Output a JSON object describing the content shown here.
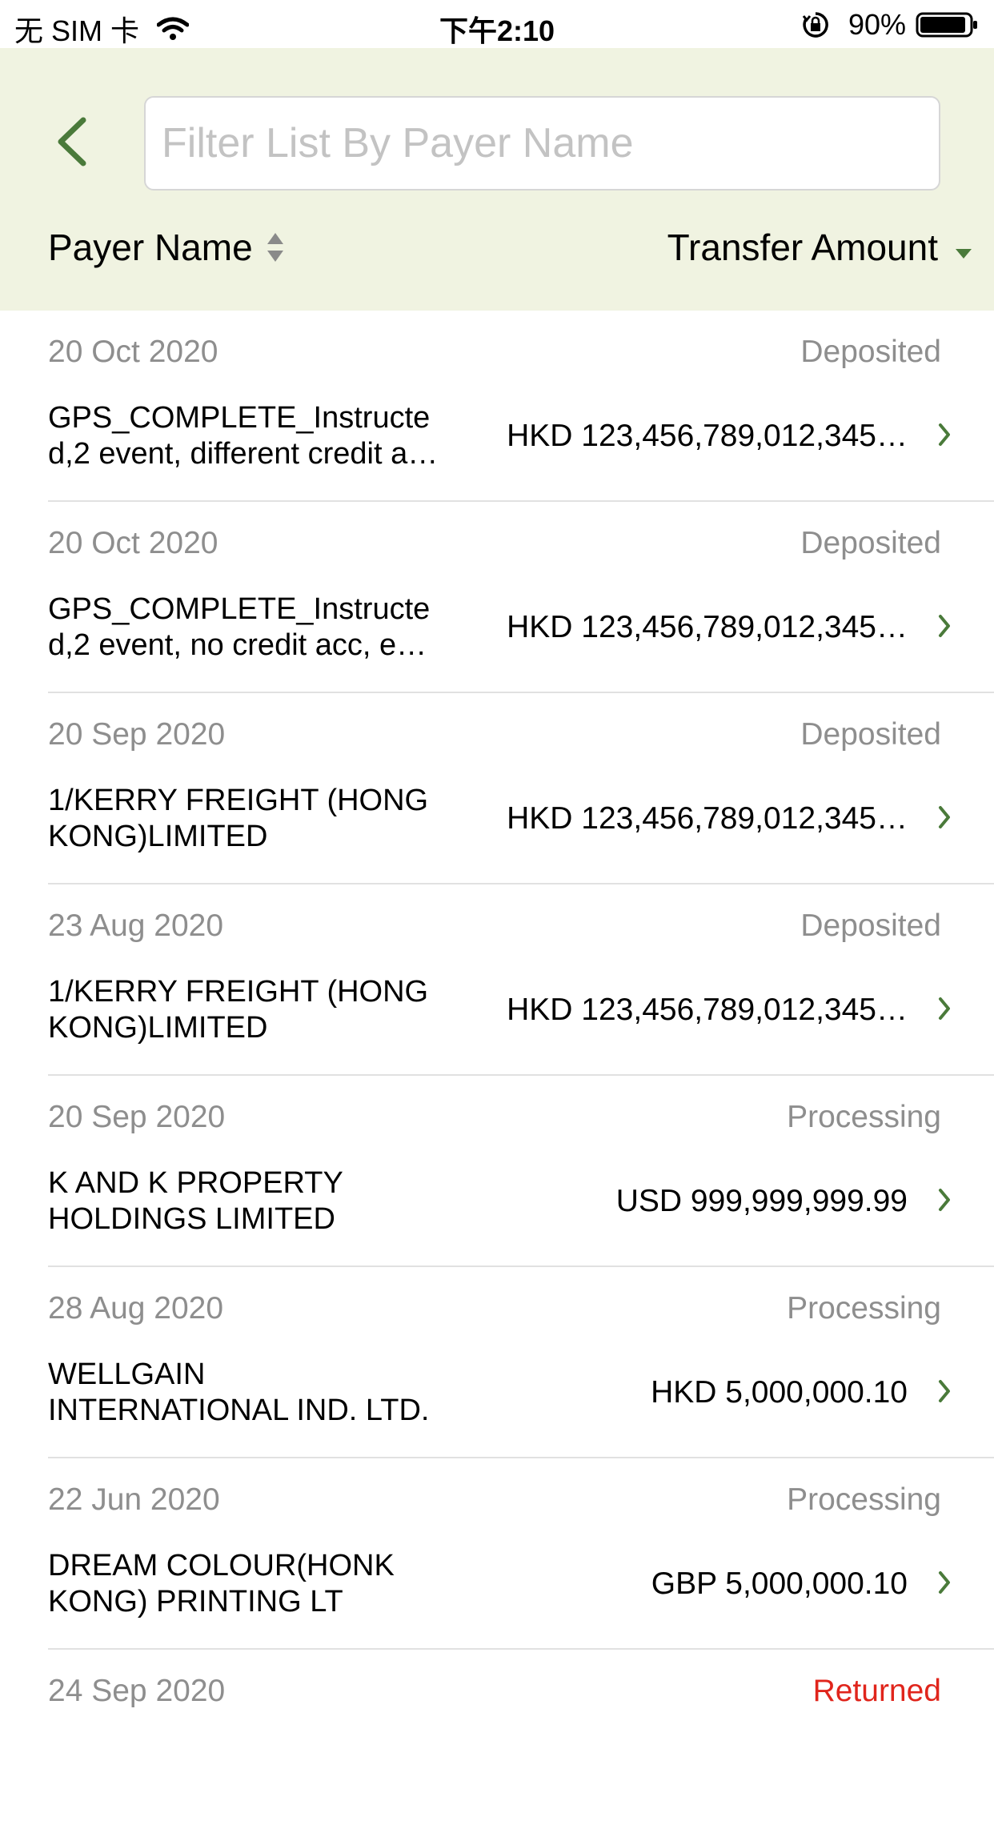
{
  "status_bar": {
    "carrier": "无 SIM 卡",
    "time": "下午2:10",
    "battery": "90%"
  },
  "header": {
    "search": {
      "placeholder": "Filter List By Payer Name",
      "value": ""
    },
    "sort_payer_label": "Payer Name",
    "sort_amount_label": "Transfer Amount",
    "accent_color": "#4a7a3a",
    "background_color": "#f0f3e1"
  },
  "transactions": [
    {
      "date": "20 Oct 2020",
      "status": "Deposited",
      "payer_line1": "GPS_COMPLETE_Instructe",
      "payer_line2": "d,2 event, different credit a…",
      "amount": "HKD 123,456,789,012,345…"
    },
    {
      "date": "20 Oct 2020",
      "status": "Deposited",
      "payer_line1": "GPS_COMPLETE_Instructe",
      "payer_line2": "d,2 event, no credit acc, e…",
      "amount": "HKD 123,456,789,012,345…"
    },
    {
      "date": "20 Sep 2020",
      "status": "Deposited",
      "payer_line1": "1/KERRY FREIGHT (HONG",
      "payer_line2": "KONG)LIMITED",
      "amount": "HKD 123,456,789,012,345…"
    },
    {
      "date": "23 Aug 2020",
      "status": "Deposited",
      "payer_line1": "1/KERRY FREIGHT (HONG",
      "payer_line2": "KONG)LIMITED",
      "amount": "HKD 123,456,789,012,345…"
    },
    {
      "date": "20 Sep 2020",
      "status": "Processing",
      "payer_line1": "K AND K PROPERTY",
      "payer_line2": "HOLDINGS LIMITED",
      "amount": "USD 999,999,999.99"
    },
    {
      "date": "28 Aug 2020",
      "status": "Processing",
      "payer_line1": "WELLGAIN",
      "payer_line2": "INTERNATIONAL IND. LTD.",
      "amount": "HKD 5,000,000.10"
    },
    {
      "date": "22 Jun 2020",
      "status": "Processing",
      "payer_line1": "DREAM COLOUR(HONK",
      "payer_line2": "KONG) PRINTING LT",
      "amount": "GBP 5,000,000.10"
    },
    {
      "date": "24 Sep 2020",
      "status": "Returned",
      "payer_line1": "",
      "payer_line2": "",
      "amount": ""
    }
  ],
  "status_colors": {
    "Returned": "#e0251c",
    "default": "#8e8e8e"
  }
}
